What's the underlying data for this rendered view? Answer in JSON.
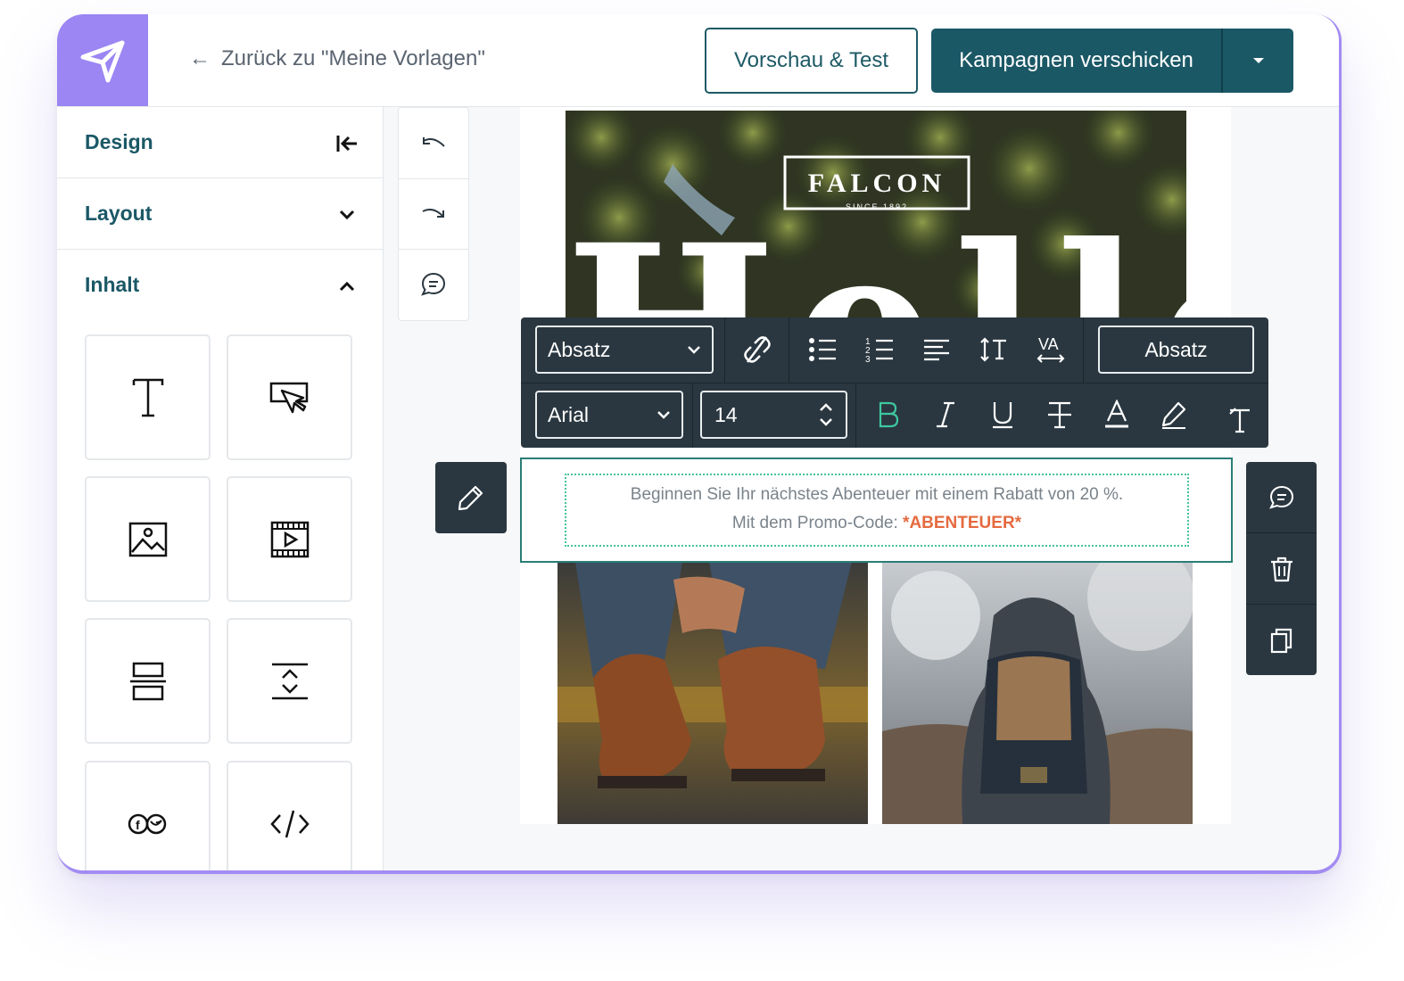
{
  "header": {
    "back_label": "Zurück zu \"Meine Vorlagen\"",
    "preview_label": "Vorschau & Test",
    "send_label": "Kampagnen verschicken"
  },
  "sidebar": {
    "design_label": "Design",
    "layout_label": "Layout",
    "content_label": "Inhalt",
    "tiles": [
      "text-icon",
      "button-icon",
      "image-icon",
      "video-icon",
      "divider-icon",
      "spacer-icon",
      "social-icon",
      "code-icon"
    ]
  },
  "hero": {
    "brand": "FALCON",
    "since": "SINCE 1892",
    "headline": "Hello"
  },
  "toolbar": {
    "paragraph_select": "Absatz",
    "paragraph_button": "Absatz",
    "font_select": "Arial",
    "font_size": "14"
  },
  "content": {
    "line1": "Beginnen Sie Ihr nächstes Abenteuer mit einem Rabatt von 20 %.",
    "line2_prefix": "Mit dem Promo-Code: ",
    "promo_code": "*ABENTEUER*"
  },
  "colors": {
    "brand_purple": "#9b86f3",
    "primary_teal": "#1b5866",
    "toolbar_dark": "#2a3740",
    "promo_orange": "#e56a3f",
    "bold_active": "#3ec7a0"
  }
}
